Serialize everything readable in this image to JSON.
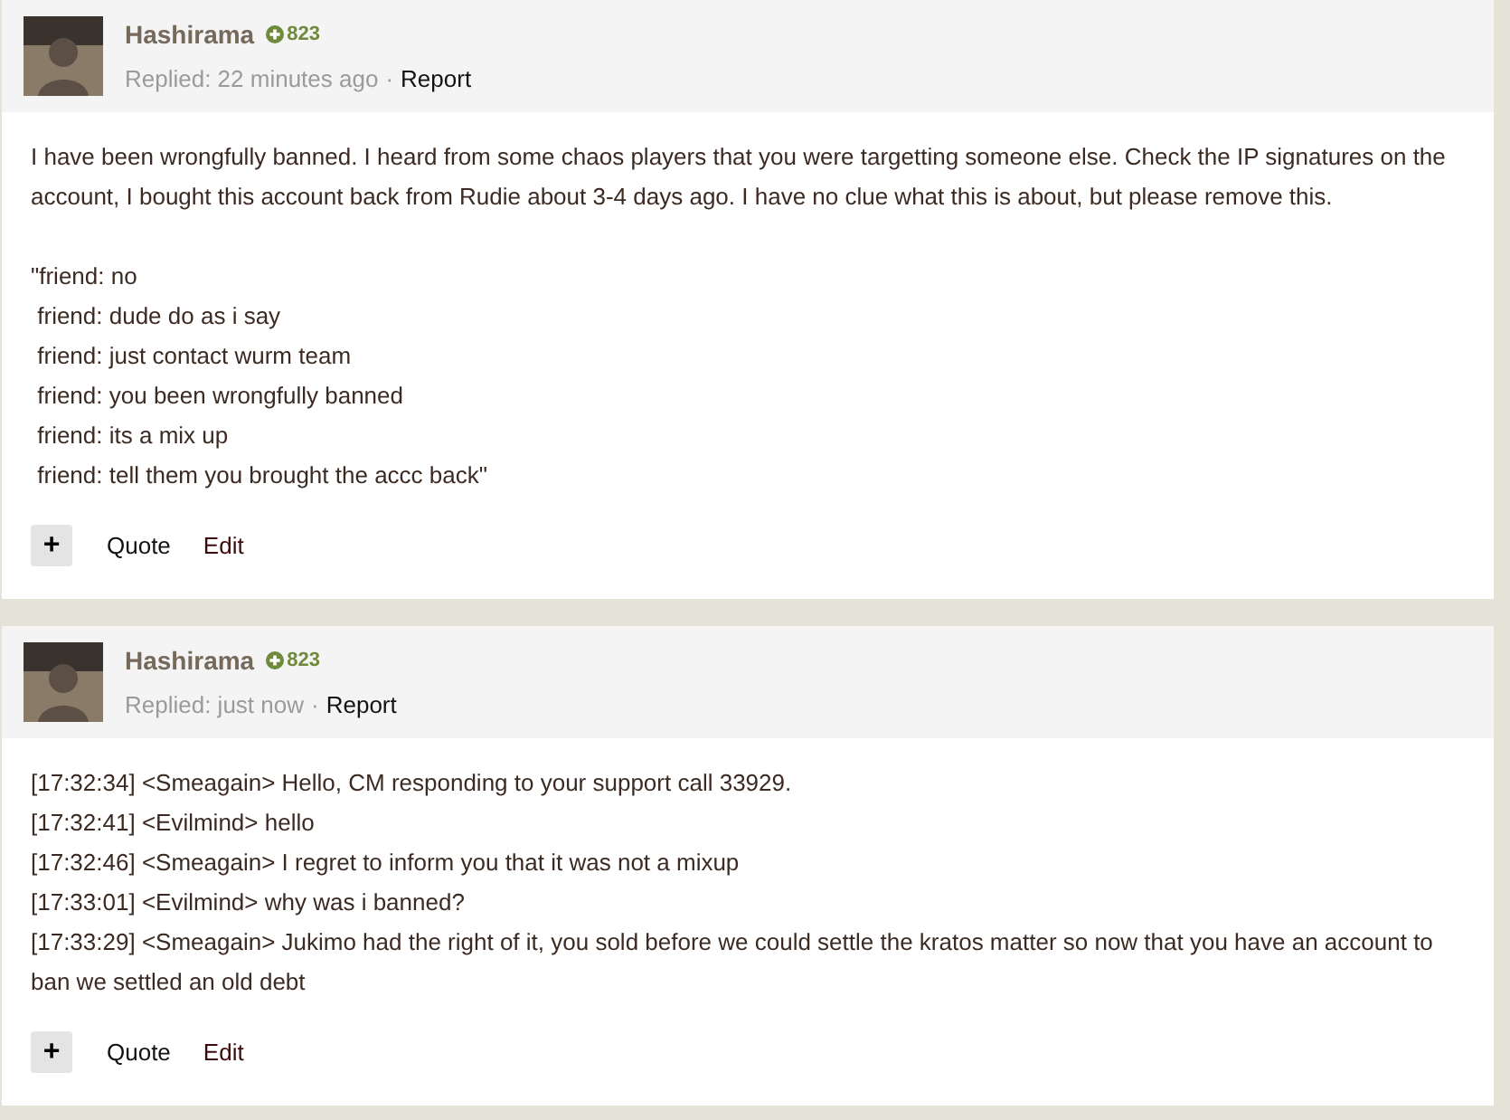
{
  "posts": [
    {
      "author": "Hashirama",
      "reputation": "823",
      "replied": "Replied: 22 minutes ago",
      "separator": "·",
      "report": "Report",
      "paragraphs": [
        [
          "I have been wrongfully banned. I heard from some chaos players that you were targetting someone else. Check the IP signatures on the account, I bought this account back from Rudie about 3-4 days ago. I have no clue what this is about, but please remove this."
        ],
        [
          "\"friend: no",
          " friend: dude do as i say",
          " friend: just contact wurm team",
          " friend: you been wrongfully banned",
          " friend: its a mix up",
          " friend: tell them you brought the accc back\""
        ]
      ],
      "actions": {
        "plus": "+",
        "quote": "Quote",
        "edit": "Edit"
      }
    },
    {
      "author": "Hashirama",
      "reputation": "823",
      "replied": "Replied: just now",
      "separator": "·",
      "report": "Report",
      "paragraphs": [
        [
          "[17:32:34] <Smeagain> Hello, CM responding to your support call 33929.",
          "[17:32:41] <Evilmind> hello",
          "[17:32:46] <Smeagain> I regret to inform you that it was not a mixup",
          "[17:33:01] <Evilmind> why was i banned?",
          "[17:33:29] <Smeagain> Jukimo had the right of it, you sold before we could settle the kratos matter so now that you have an account to ban we settled an old debt"
        ]
      ],
      "actions": {
        "plus": "+",
        "quote": "Quote",
        "edit": "Edit"
      }
    }
  ]
}
